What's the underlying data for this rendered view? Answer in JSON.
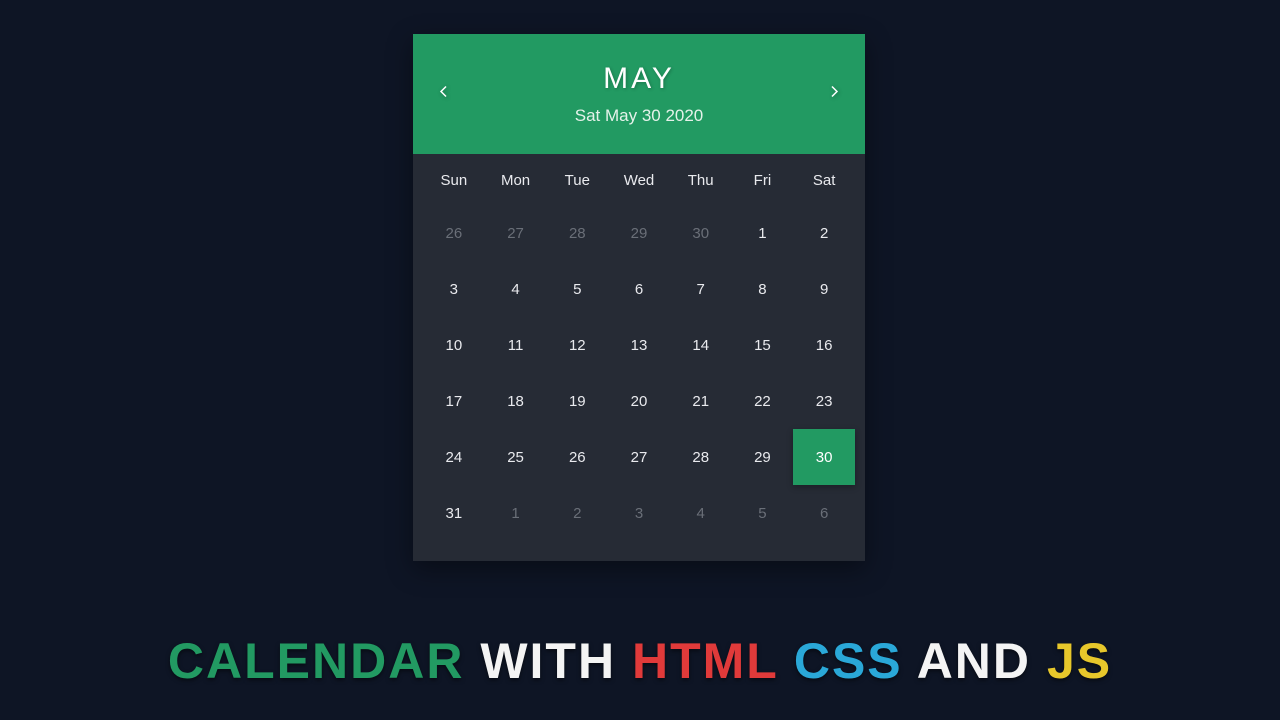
{
  "calendar": {
    "month": "MAY",
    "date_string": "Sat May 30 2020",
    "weekdays": [
      "Sun",
      "Mon",
      "Tue",
      "Wed",
      "Thu",
      "Fri",
      "Sat"
    ],
    "days": [
      {
        "n": "26",
        "muted": true
      },
      {
        "n": "27",
        "muted": true
      },
      {
        "n": "28",
        "muted": true
      },
      {
        "n": "29",
        "muted": true
      },
      {
        "n": "30",
        "muted": true
      },
      {
        "n": "1"
      },
      {
        "n": "2"
      },
      {
        "n": "3"
      },
      {
        "n": "4"
      },
      {
        "n": "5"
      },
      {
        "n": "6"
      },
      {
        "n": "7"
      },
      {
        "n": "8"
      },
      {
        "n": "9"
      },
      {
        "n": "10"
      },
      {
        "n": "11"
      },
      {
        "n": "12"
      },
      {
        "n": "13"
      },
      {
        "n": "14"
      },
      {
        "n": "15"
      },
      {
        "n": "16"
      },
      {
        "n": "17"
      },
      {
        "n": "18"
      },
      {
        "n": "19"
      },
      {
        "n": "20"
      },
      {
        "n": "21"
      },
      {
        "n": "22"
      },
      {
        "n": "23"
      },
      {
        "n": "24"
      },
      {
        "n": "25"
      },
      {
        "n": "26"
      },
      {
        "n": "27"
      },
      {
        "n": "28"
      },
      {
        "n": "29"
      },
      {
        "n": "30",
        "selected": true
      },
      {
        "n": "31"
      },
      {
        "n": "1",
        "muted": true
      },
      {
        "n": "2",
        "muted": true
      },
      {
        "n": "3",
        "muted": true
      },
      {
        "n": "4",
        "muted": true
      },
      {
        "n": "5",
        "muted": true
      },
      {
        "n": "6",
        "muted": true
      }
    ]
  },
  "caption": {
    "w1": "CALENDAR",
    "w2": "WITH",
    "w3": "HTML",
    "w4": "CSS",
    "w5": "AND",
    "w6": "JS"
  }
}
